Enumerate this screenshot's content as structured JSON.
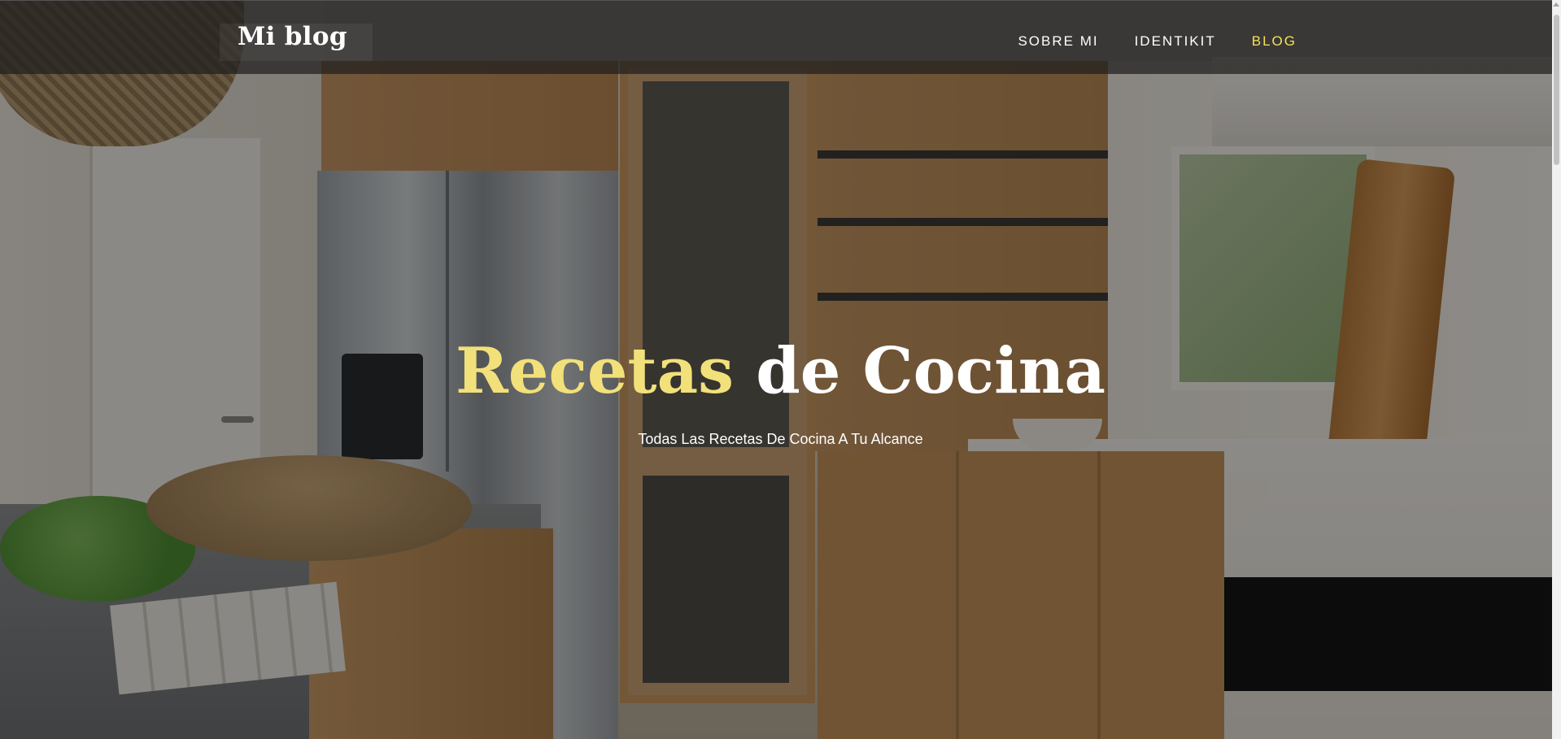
{
  "navbar": {
    "brand": "Mi blog",
    "links": [
      {
        "label": "SOBRE MI",
        "active": false
      },
      {
        "label": "IDENTIKIT",
        "active": false
      },
      {
        "label": "BLOG",
        "active": true
      }
    ]
  },
  "hero": {
    "title_accent": "Recetas",
    "title_rest": "de Cocina",
    "subtitle": "Todas Las Recetas De Cocina A Tu Alcance",
    "background": "kitchen-photo"
  },
  "colors": {
    "accent": "#f2e07a",
    "nav_active": "#f5e15a",
    "nav_text": "#ffffff",
    "navbar_bg": "rgba(30,30,30,0.72)"
  }
}
